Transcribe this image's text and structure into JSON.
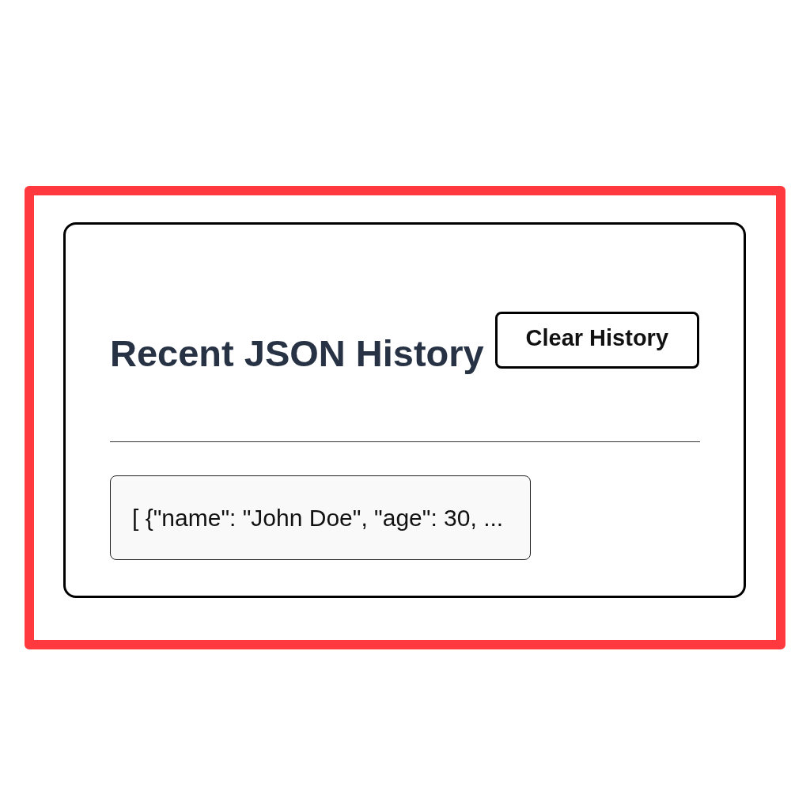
{
  "title": "Recent JSON History",
  "clear_button": "Clear History",
  "history": [
    {
      "preview": "[ {\"name\": \"John Doe\", \"age\": 30, ..."
    }
  ]
}
